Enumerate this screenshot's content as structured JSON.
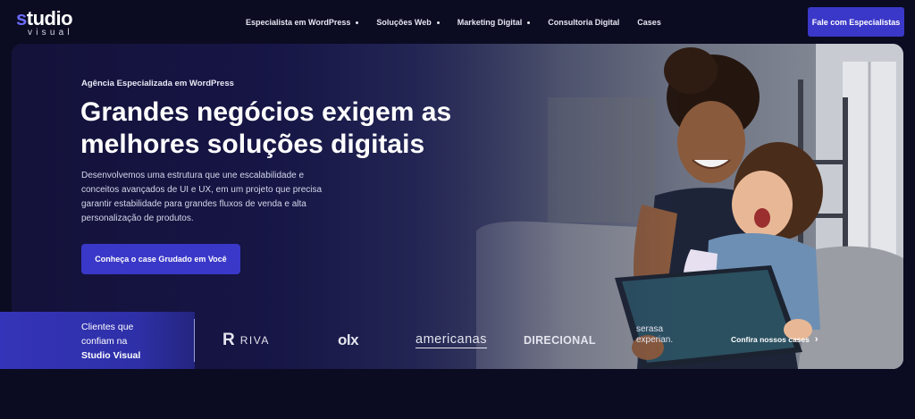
{
  "brand": {
    "name_s": "s",
    "name_rest": "tudio",
    "sub": "visual"
  },
  "nav": {
    "items": [
      {
        "label": "Especialista em WordPress",
        "has_dropdown": true
      },
      {
        "label": "Soluções Web",
        "has_dropdown": true
      },
      {
        "label": "Marketing Digital",
        "has_dropdown": true
      },
      {
        "label": "Consultoria Digital",
        "has_dropdown": false
      },
      {
        "label": "Cases",
        "has_dropdown": false
      }
    ],
    "cta_label": "Fale com Especialistas"
  },
  "hero": {
    "eyebrow": "Agência Especializada em WordPress",
    "headline": "Grandes negócios exigem as melhores soluções digitais",
    "body": "Desenvolvemos uma estrutura que une escalabilidade e conceitos avançados de UI e UX, em um projeto que precisa garantir estabilidade para grandes fluxos de venda e alta personalização de produtos.",
    "cta_label": "Conheça o case Grudado em Você"
  },
  "clients": {
    "label_line1": "Clientes que",
    "label_line2": "confiam na",
    "label_bold": "Studio Visual",
    "logos": {
      "riva_mark": "R",
      "riva_text": "RIVA",
      "olx": "olx",
      "americanas": "americanas",
      "direcional": "DIRECIONAL",
      "serasa_1": "serasa",
      "serasa_2": "experian."
    },
    "cases_link": "Confira nossos cases",
    "cases_chevron": "›"
  },
  "colors": {
    "background": "#0b0b22",
    "accent": "#3a38c8",
    "brand_s": "#6b6bff"
  },
  "icons": [
    "dropdown-dot-icon",
    "chevron-right-icon"
  ]
}
